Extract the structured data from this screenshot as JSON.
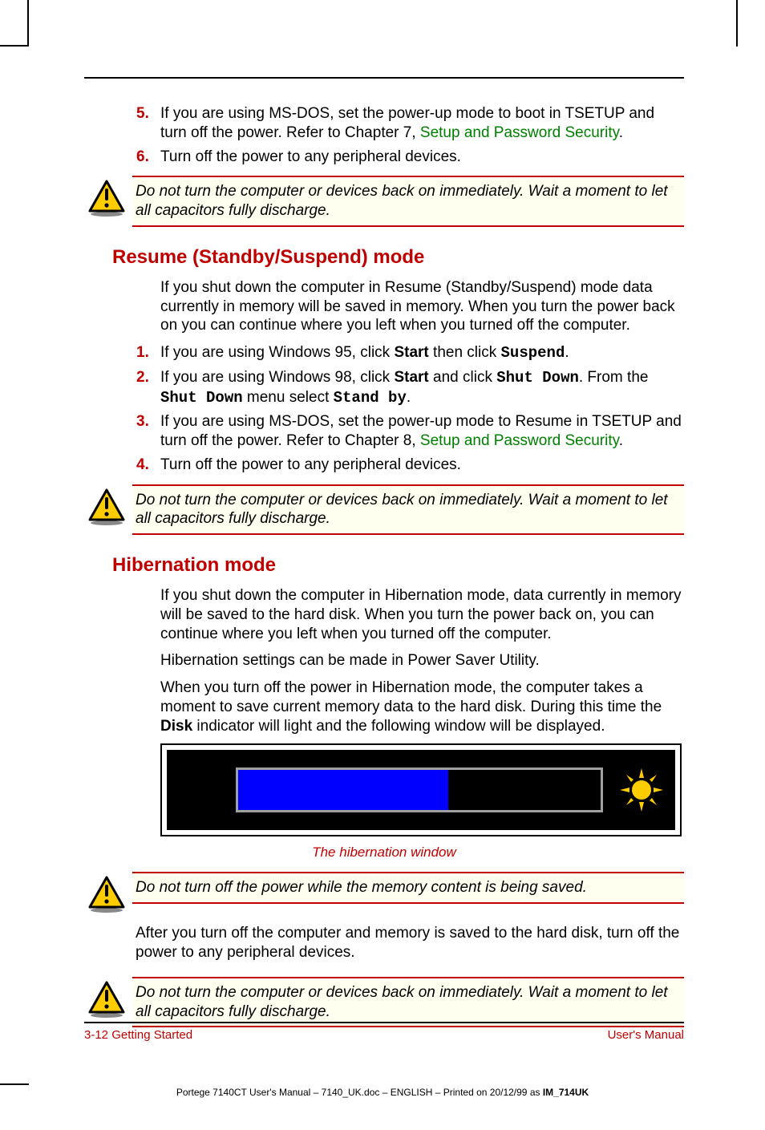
{
  "list1": {
    "item5": {
      "num": "5.",
      "text_a": "If you are using MS-DOS, set the power-up mode to boot in TSETUP and turn off the power. Refer to Chapter 7, ",
      "link": "Setup and Password Security",
      "text_b": "."
    },
    "item6": {
      "num": "6.",
      "text": "Turn off the power to any peripheral devices."
    }
  },
  "caution1": "Do not turn the computer or devices back on immediately. Wait a moment to let all capacitors fully discharge.",
  "section1": {
    "heading": "Resume (Standby/Suspend) mode",
    "intro": "If you shut down the computer in Resume (Standby/Suspend) mode data currently in memory will be saved in memory. When you turn the power back on you can continue where you left when you turned off the computer.",
    "item1": {
      "num": "1.",
      "pre": "If you are using Windows 95, click ",
      "b1": "Start",
      "mid": " then click ",
      "m1": "Suspend",
      "post": "."
    },
    "item2": {
      "num": "2.",
      "pre": "If you are using Windows 98, click ",
      "b1": "Start",
      "mid1": " and click ",
      "m1": "Shut Down",
      "mid2": ". From the ",
      "m2": "Shut Down",
      "mid3": " menu select ",
      "m3": "Stand by",
      "post": "."
    },
    "item3": {
      "num": "3.",
      "pre": "If you are using MS-DOS, set the power-up mode to Resume in TSETUP and turn off the power. Refer to Chapter 8, ",
      "link": "Setup and Password Security",
      "post": "."
    },
    "item4": {
      "num": "4.",
      "text": "Turn off the power to any peripheral devices."
    }
  },
  "caution2": "Do not turn the computer or devices back on immediately. Wait a moment to let all capacitors fully discharge.",
  "section2": {
    "heading": "Hibernation mode",
    "p1": "If you shut down the computer in Hibernation mode, data currently in memory will be saved to the hard disk. When you turn the power back on, you can continue where you left when you turned off the computer.",
    "p2": "Hibernation settings can be made in Power Saver Utility.",
    "p3_pre": "When you turn off the power in Hibernation mode, the computer takes a moment to save current memory data to the hard disk. During this time the ",
    "p3_b": "Disk",
    "p3_post": " indicator will light and the following window will be displayed.",
    "figcaption": "The hibernation window"
  },
  "caution3": "Do not turn off the power while the memory content is being saved.",
  "after3": "After you turn off the computer and memory is saved to the hard disk, turn off the power to any peripheral devices.",
  "caution4": "Do not turn the computer or devices back on immediately. Wait a moment to let all capacitors fully discharge.",
  "footer": {
    "left": "3-12  Getting Started",
    "right": "User's Manual"
  },
  "subfooter": {
    "pre": "Portege 7140CT User's Manual  – 7140_UK.doc – ENGLISH – Printed on 20/12/99 as ",
    "bold": "IM_714UK"
  },
  "icons": {
    "warning": "warning-triangle",
    "moon": "moon-icon",
    "sun": "sun-icon"
  }
}
